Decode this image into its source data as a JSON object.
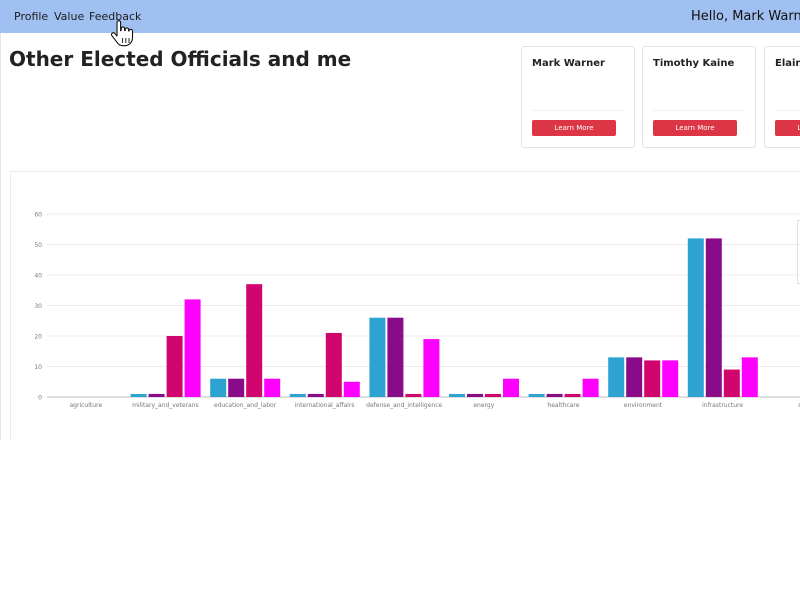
{
  "navbar": {
    "items": [
      "Profile",
      "Value",
      "Feedback"
    ],
    "greeting": "Hello, Mark Warner",
    "background": "#a1c0f2"
  },
  "page": {
    "title": "Other Elected Officials and me"
  },
  "cards": [
    {
      "name": "Mark Warner",
      "button": "Learn More"
    },
    {
      "name": "Timothy Kaine",
      "button": "Learn More"
    },
    {
      "name": "Elaine",
      "button": "Learn More"
    }
  ],
  "colors": {
    "series": [
      "#2ea3d1",
      "#8a0b8a",
      "#d1056e",
      "#ff00ff"
    ],
    "button": "#dc3545"
  },
  "chart_data": {
    "type": "bar",
    "categories": [
      "agriculture",
      "military_and_veterans",
      "education_and_labor",
      "international_affairs",
      "defense_and_intelligence",
      "energy",
      "healthcare",
      "environment",
      "infrastructure",
      "sci"
    ],
    "series": [
      {
        "values": [
          0,
          1,
          6,
          1,
          26,
          1,
          1,
          13,
          52,
          0
        ]
      },
      {
        "values": [
          0,
          1,
          6,
          1,
          26,
          1,
          1,
          13,
          52,
          0
        ]
      },
      {
        "values": [
          0,
          20,
          37,
          21,
          1,
          1,
          1,
          12,
          9,
          0
        ]
      },
      {
        "values": [
          0,
          32,
          6,
          5,
          19,
          6,
          6,
          12,
          13,
          0
        ]
      }
    ],
    "yticks": [
      0,
      10,
      20,
      30,
      40,
      50,
      60
    ],
    "ylim": [
      0,
      60
    ],
    "grid": true,
    "legend": "top-right"
  },
  "icons": {
    "cursor": "hand-pointer-icon"
  }
}
